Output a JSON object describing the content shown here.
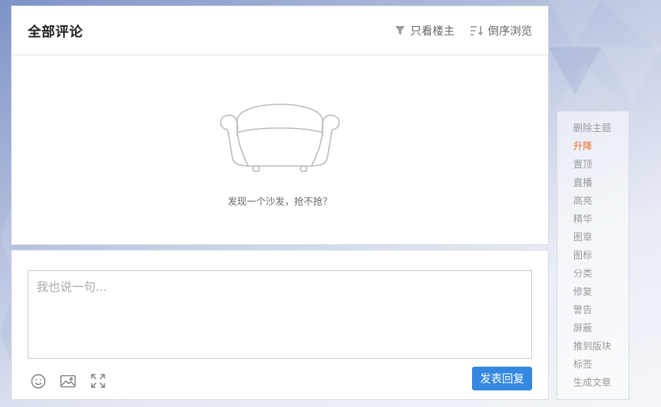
{
  "comments": {
    "title": "全部评论",
    "actions": [
      {
        "label": "只看楼主",
        "icon": "filter-icon"
      },
      {
        "label": "倒序浏览",
        "icon": "sort-icon"
      }
    ],
    "empty_text": "发现一个沙发，抢不抢？",
    "empty_icon": "sofa-icon"
  },
  "reply": {
    "placeholder": "我也说一句...",
    "tools": [
      "emoji-icon",
      "image-icon",
      "fullscreen-icon"
    ],
    "submit_label": "发表回复",
    "accent": "#3388e0"
  },
  "admin": {
    "active_color": "#ec6a2b",
    "items": [
      {
        "label": "删除主题",
        "active": false
      },
      {
        "label": "升降",
        "active": true
      },
      {
        "label": "置顶",
        "active": false
      },
      {
        "label": "直播",
        "active": false
      },
      {
        "label": "高亮",
        "active": false
      },
      {
        "label": "精华",
        "active": false
      },
      {
        "label": "图章",
        "active": false
      },
      {
        "label": "图标",
        "active": false
      },
      {
        "label": "分类",
        "active": false
      },
      {
        "label": "修复",
        "active": false
      },
      {
        "label": "警告",
        "active": false
      },
      {
        "label": "屏蔽",
        "active": false
      },
      {
        "label": "推到版块",
        "active": false
      },
      {
        "label": "标签",
        "active": false
      },
      {
        "label": "生成文章",
        "active": false
      }
    ]
  }
}
